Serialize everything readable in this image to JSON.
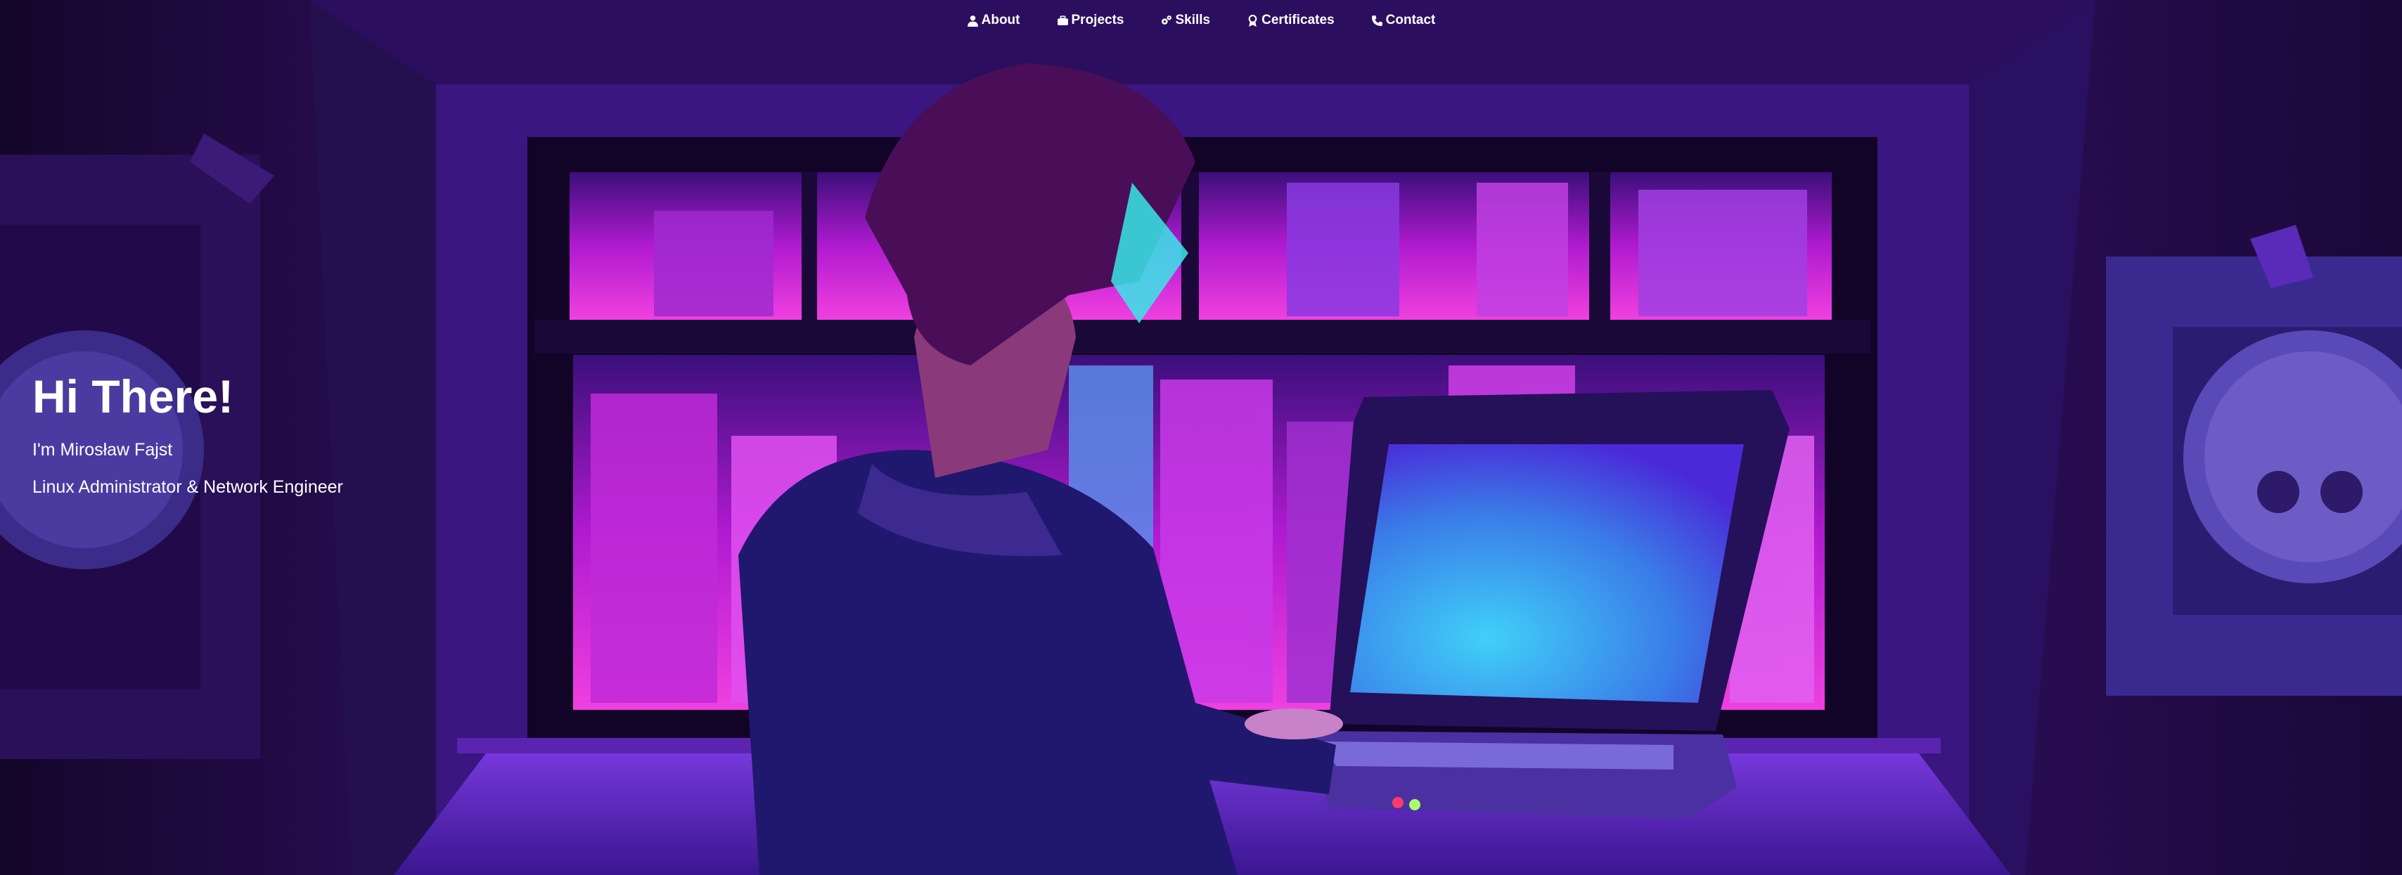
{
  "nav": {
    "items": [
      {
        "label": "About",
        "icon": "user-icon"
      },
      {
        "label": "Projects",
        "icon": "briefcase-icon"
      },
      {
        "label": "Skills",
        "icon": "gears-icon"
      },
      {
        "label": "Certificates",
        "icon": "award-icon"
      },
      {
        "label": "Contact",
        "icon": "phone-icon"
      }
    ]
  },
  "hero": {
    "title": "Hi There!",
    "intro": "I'm Mirosław Fajst",
    "role": "Linux Administrator & Network Engineer"
  },
  "colors": {
    "background": "#1a0833",
    "accent_magenta": "#e020e8",
    "accent_purple": "#6a2cc8",
    "screen_blue": "#3aa8f0"
  }
}
